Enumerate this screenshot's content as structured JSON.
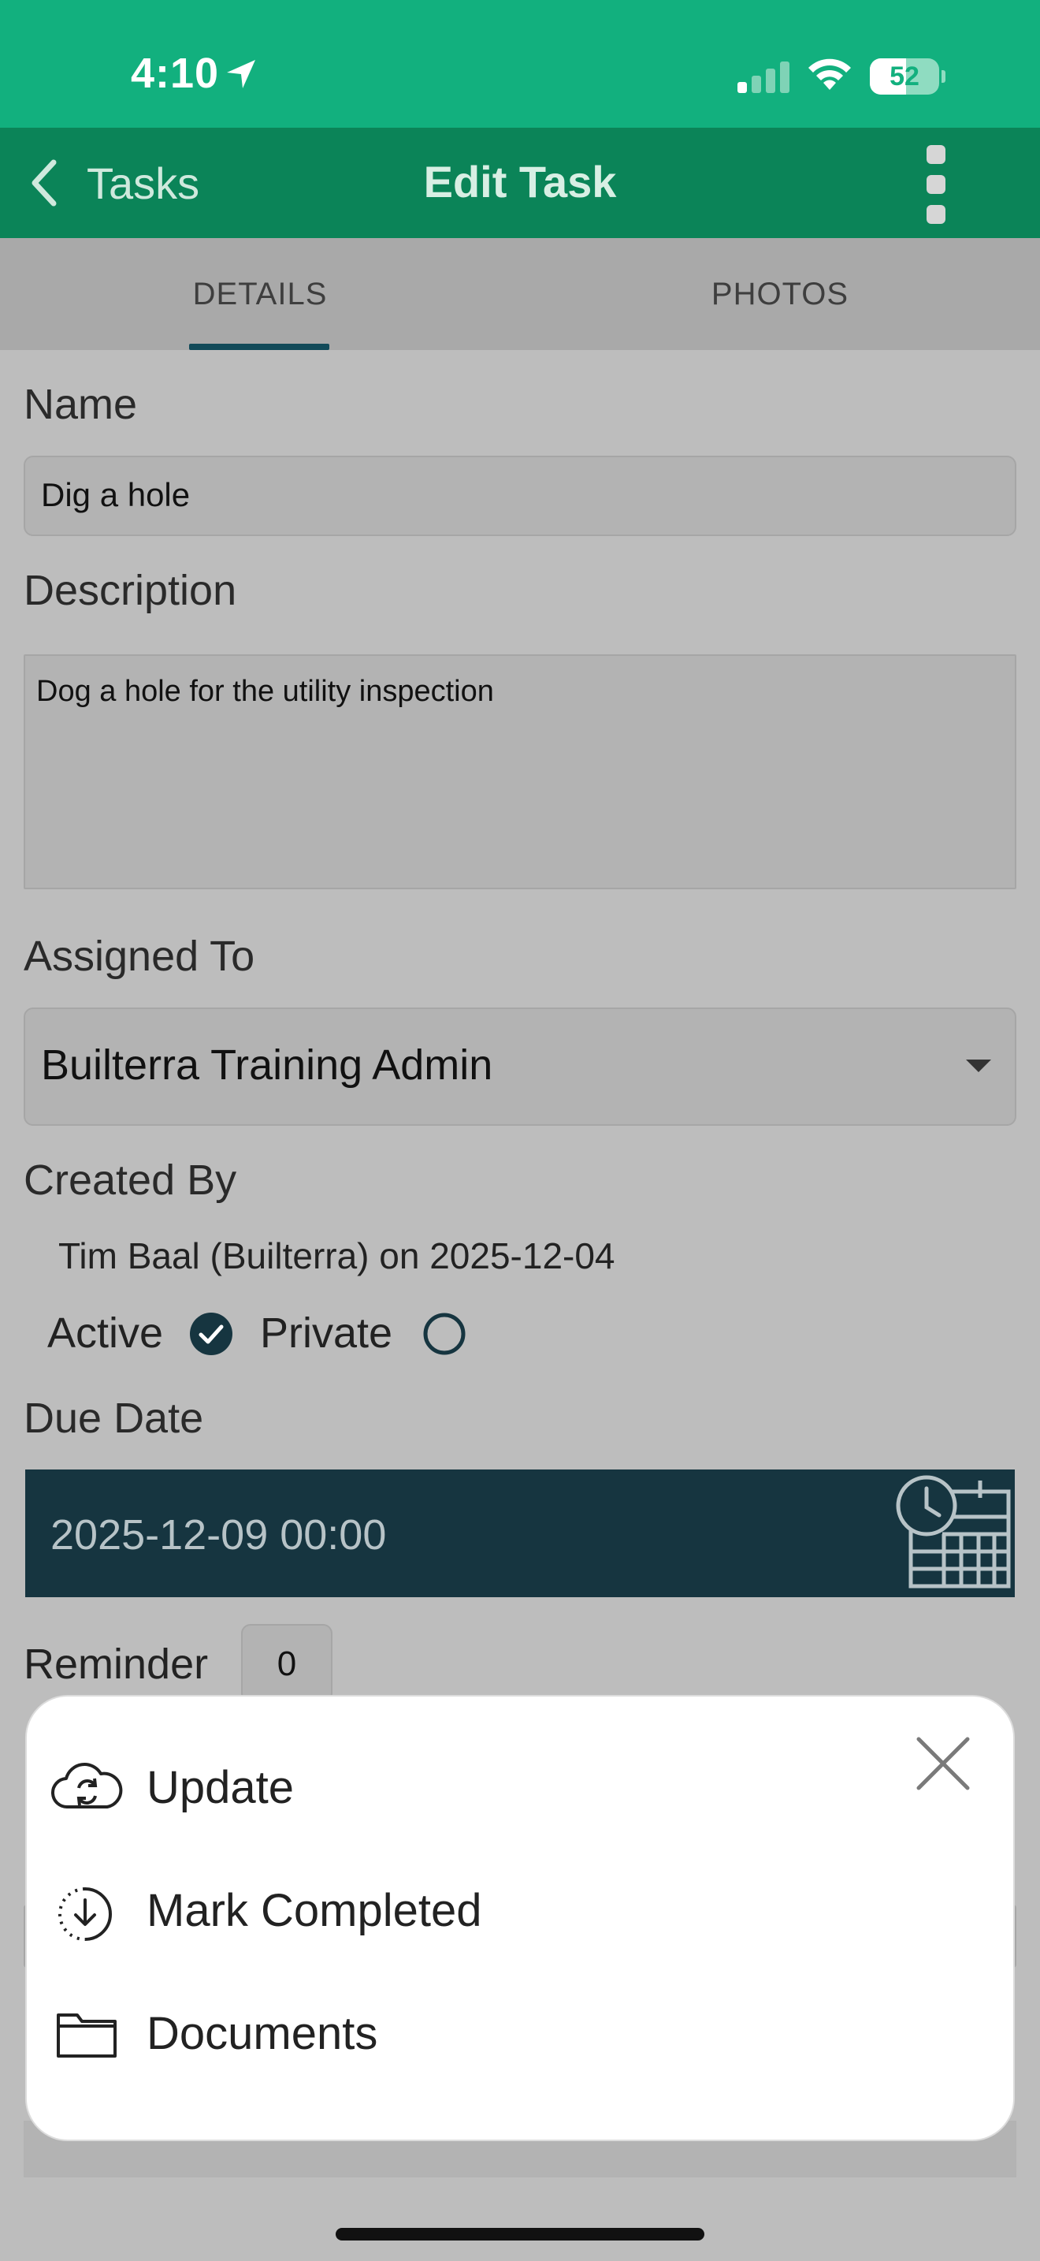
{
  "status_bar": {
    "time": "4:10",
    "battery": "52",
    "battery_level_percent": 52
  },
  "nav": {
    "back_label": "Tasks",
    "title": "Edit Task"
  },
  "tabs": [
    {
      "label": "DETAILS",
      "selected": true
    },
    {
      "label": "PHOTOS",
      "selected": false
    }
  ],
  "form": {
    "name_label": "Name",
    "name_value": "Dig a hole",
    "description_label": "Description",
    "description_value": "Dog a hole for the utility inspection",
    "assigned_label": "Assigned To",
    "assigned_value": "Builterra Training Admin",
    "created_label": "Created By",
    "created_value": "Tim Baal (Builterra) on 2025-12-04",
    "active_label": "Active",
    "active_checked": true,
    "private_label": "Private",
    "private_checked": false,
    "due_label": "Due Date",
    "due_value": "2025-12-09 00:00",
    "reminder_label": "Reminder",
    "reminder_value": "0"
  },
  "action_sheet": {
    "items": [
      {
        "label": "Update",
        "icon": "cloud-sync-icon"
      },
      {
        "label": "Mark Completed",
        "icon": "download-circle-icon"
      },
      {
        "label": "Documents",
        "icon": "folder-icon"
      }
    ]
  },
  "colors": {
    "status_bar": "#12b07e",
    "nav_bar": "#0b8458",
    "due_field": "#163540",
    "check": "#163540"
  }
}
